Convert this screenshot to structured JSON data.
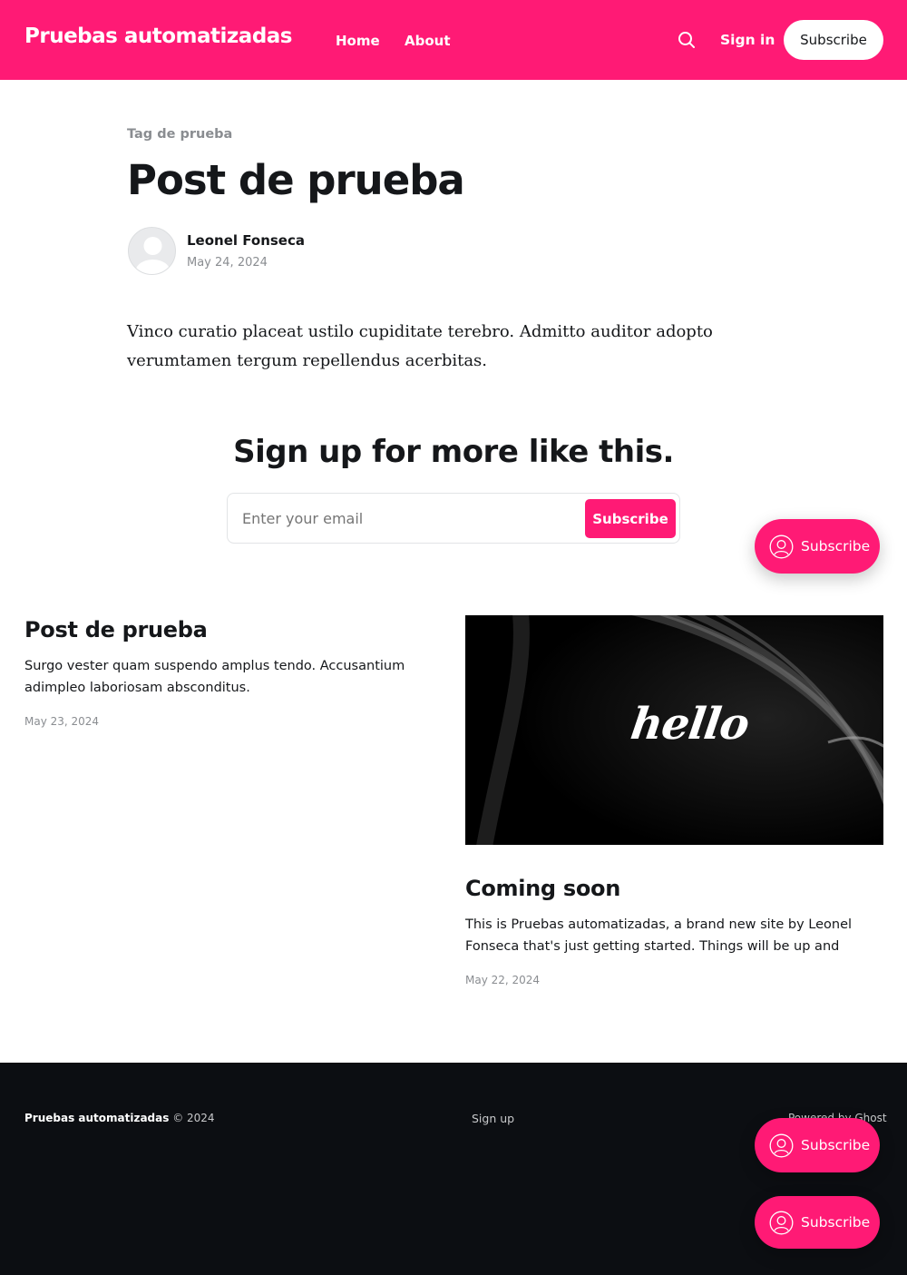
{
  "header": {
    "brand": "Pruebas automatizadas",
    "nav": [
      {
        "label": "Home"
      },
      {
        "label": "About"
      }
    ],
    "search_icon": "search-icon",
    "sign_in": "Sign in",
    "subscribe": "Subscribe"
  },
  "article": {
    "tag": "Tag de prueba",
    "title": "Post de prueba",
    "author": "Leonel Fonseca",
    "date": "May 24, 2024",
    "excerpt": "Vinco curatio placeat ustilo cupiditate terebro. Admitto auditor adopto verumtamen tergum repellendus acerbitas."
  },
  "cta": {
    "title": "Sign up for more like this.",
    "placeholder": "Enter your email",
    "button": "Subscribe"
  },
  "feed": [
    {
      "title": "Post de prueba",
      "excerpt": "Surgo vester quam suspendo amplus tendo. Accusantium adimpleo laboriosam absconditus.",
      "date": "May 23, 2024"
    },
    {
      "image_text": "hello",
      "title": "Coming soon",
      "excerpt": "This is Pruebas automatizadas, a brand new site by Leonel Fonseca that's just getting started. Things will be up and runnin...",
      "date": "May 22, 2024"
    }
  ],
  "portal_buttons": [
    {
      "label": "Subscribe",
      "icon": "user-circle-icon"
    },
    {
      "label": "Subscribe",
      "icon": "user-circle-icon"
    },
    {
      "label": "Subscribe",
      "icon": "user-circle-icon"
    }
  ],
  "footer": {
    "brand": "Pruebas automatizadas",
    "copyright": " © 2024",
    "signup": "Sign up",
    "powered": "Powered by Ghost"
  },
  "colors": {
    "accent": "#ff1a75",
    "footer_bg": "#0c0e12"
  }
}
